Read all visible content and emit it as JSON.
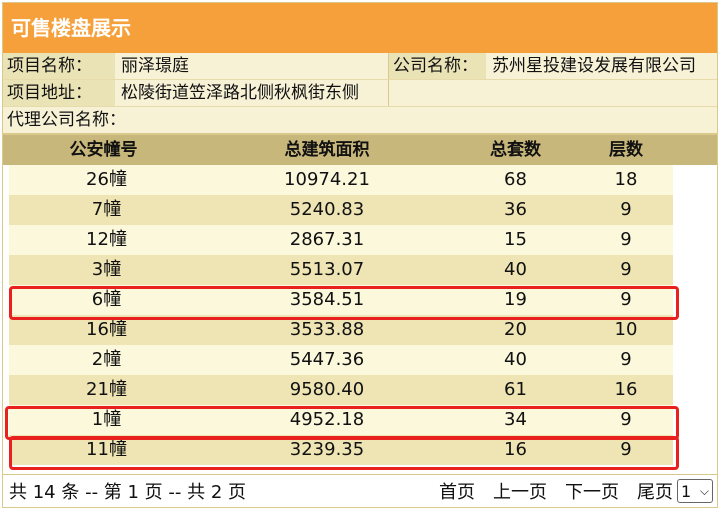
{
  "header": {
    "title": "可售楼盘展示"
  },
  "info": {
    "project_name_label": "项目名称：",
    "project_name": "丽泽璟庭",
    "company_label": "公司名称：",
    "company": "苏州星投建设发展有限公司",
    "address_label": "项目地址：",
    "address": "松陵街道笠泽路北侧秋枫街东侧",
    "agent_label": "代理公司名称："
  },
  "table": {
    "headers": [
      "公安幢号",
      "总建筑面积",
      "总套数",
      "层数"
    ],
    "rows": [
      [
        "26幢",
        "10974.21",
        "68",
        "18"
      ],
      [
        "7幢",
        "5240.83",
        "36",
        "9"
      ],
      [
        "12幢",
        "2867.31",
        "15",
        "9"
      ],
      [
        "3幢",
        "5513.07",
        "40",
        "9"
      ],
      [
        "6幢",
        "3584.51",
        "19",
        "9"
      ],
      [
        "16幢",
        "3533.88",
        "20",
        "10"
      ],
      [
        "2幢",
        "5447.36",
        "40",
        "9"
      ],
      [
        "21幢",
        "9580.40",
        "61",
        "16"
      ],
      [
        "1幢",
        "4952.18",
        "34",
        "9"
      ],
      [
        "11幢",
        "3239.35",
        "16",
        "9"
      ]
    ]
  },
  "footer": {
    "summary": "共 14 条 -- 第 1 页 -- 共 2 页",
    "first": "首页",
    "prev": "上一页",
    "next": "下一页",
    "last": "尾页",
    "page_select": "1"
  },
  "colors": {
    "header_bg": "#f5a03a",
    "table_header_bg": "#c8b77a",
    "highlight": "#e8201e"
  }
}
